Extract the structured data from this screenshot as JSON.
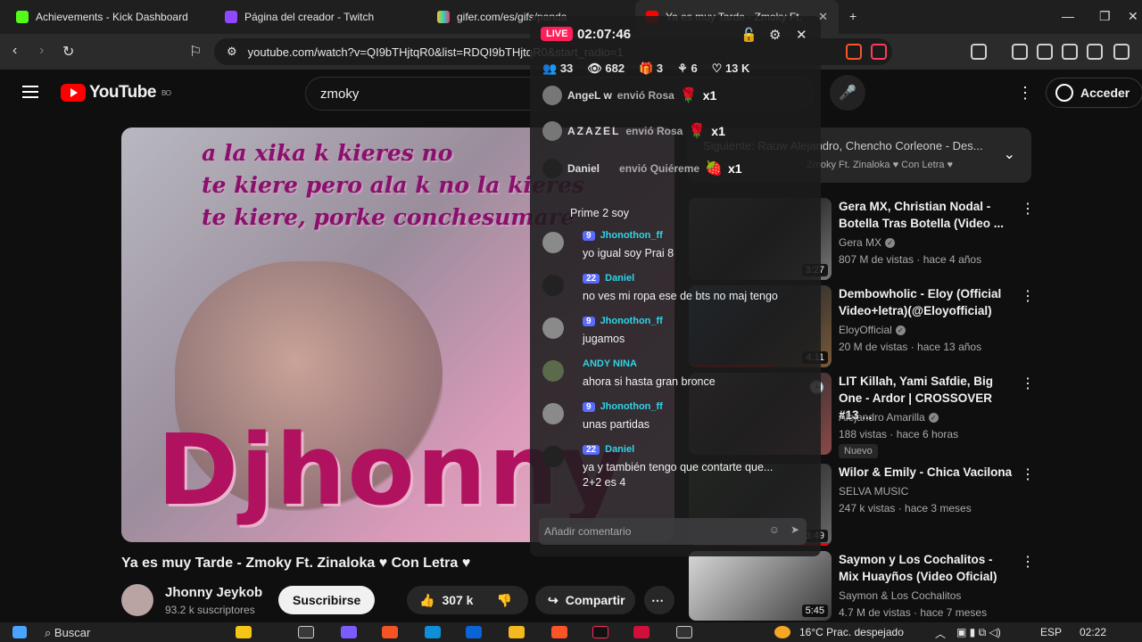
{
  "browser": {
    "tabs": [
      {
        "label": "Achievements - Kick Dashboard"
      },
      {
        "label": "Página del creador - Twitch"
      },
      {
        "label": "gifer.com/es/gifs/panda"
      },
      {
        "label": "Ya es muy Tarde - Zmoky Ft."
      }
    ],
    "url": "youtube.com/watch?v=QI9bTHjtqR0&list=RDQI9bTHjtqR0&start_radio=1"
  },
  "youtube": {
    "logo_text": "YouTube",
    "region": "BO",
    "search_value": "zmoky",
    "signin_label": "Acceder",
    "video": {
      "lyrics": [
        "a la xika k kieres no",
        "te kiere pero ala k no la kieres",
        "te kiere, porke conchesumare"
      ],
      "overlay_name": "Djhonny",
      "title": "Ya es muy Tarde - Zmoky Ft. Zinaloka ♥ Con Letra ♥",
      "channel": "Jhonny Jeykob",
      "subs": "93.2 k suscriptores",
      "subscribe_label": "Suscribirse",
      "likes": "307 k",
      "share_label": "Compartir"
    },
    "up_next": {
      "line1": "Siguiente: Rauw Alejandro, Chencho Corleone - Des...",
      "line2": "Zmoky Ft. Zinaloka ♥ Con Letra ♥"
    },
    "recommendations": [
      {
        "title": "Gera MX, Christian Nodal - Botella Tras Botella (Video ...",
        "channel": "Gera MX",
        "meta": "807 M de vistas · hace 4 años",
        "duration": "3:27"
      },
      {
        "title": "Dembowholic - Eloy (Official Video+letra)(@Eloyofficial)",
        "channel": "EloyOfficial",
        "meta": "20 M de vistas · hace 13 años",
        "duration": "4:11"
      },
      {
        "title": "LIT Killah, Yami Safdie, Big One - Ardor | CROSSOVER #13 ...",
        "channel": "Alejandro Amarilla",
        "meta": "188 vistas · hace 6 horas",
        "badge": "Nuevo",
        "duration": ""
      },
      {
        "title": "Wilor & Emily - Chica Vacilona",
        "channel": "SELVA MUSIC",
        "meta": "247 k vistas · hace 3 meses",
        "duration": "3:49"
      },
      {
        "title": "Saymon y Los Cochalitos - Mix Huayños (Video Oficial)",
        "channel": "Saymon & Los Cochalitos",
        "meta": "4.7 M de vistas · hace 7 meses",
        "duration": "5:45"
      }
    ]
  },
  "chat": {
    "live_label": "LIVE",
    "timer": "02:07:46",
    "stats": {
      "viewers": "33",
      "views": "682",
      "gifts": "3",
      "shares": "6",
      "likes": "13 K"
    },
    "gifts": [
      {
        "user": "AngeL w",
        "action": "envió Rosa",
        "count": "x1"
      },
      {
        "user": "AZAZEL",
        "action": "envió Rosa",
        "count": "x1"
      },
      {
        "user": "Daniel",
        "action": "envió Quiéreme",
        "count": "x1"
      }
    ],
    "plain_message": "Prime 2 soy",
    "messages": [
      {
        "level": "9",
        "user": "Jhonothon_ff",
        "text": "yo igual soy Prai 8",
        "text2": ""
      },
      {
        "level": "22",
        "user": "Daniel",
        "text": "no ves mi ropa ese de bts no maj tengo",
        "text2": ""
      },
      {
        "level": "9",
        "user": "Jhonothon_ff",
        "text": "jugamos",
        "text2": ""
      },
      {
        "level": "",
        "user": "ANDY NINA",
        "text": "ahora si hasta gran bronce",
        "text2": ""
      },
      {
        "level": "9",
        "user": "Jhonothon_ff",
        "text": "unas partidas",
        "text2": ""
      },
      {
        "level": "22",
        "user": "Daniel",
        "text": "ya y también tengo que contarte que...",
        "text2": "2+2 es 4"
      }
    ],
    "comment_placeholder": "Añadir comentario"
  },
  "taskbar": {
    "search_label": "Buscar",
    "weather": "16°C  Prac. despejado",
    "lang": "ESP",
    "time": "02:22"
  }
}
